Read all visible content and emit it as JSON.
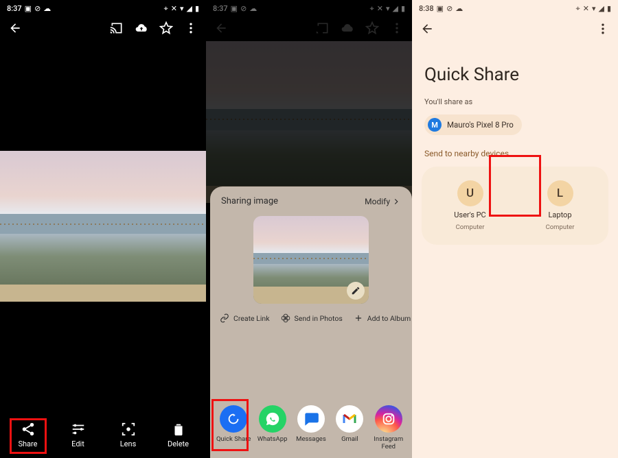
{
  "status": {
    "time1": "8:37",
    "time2": "8:37",
    "time3": "8:38"
  },
  "panel1": {
    "actions": {
      "share": "Share",
      "edit": "Edit",
      "lens": "Lens",
      "delete": "Delete"
    }
  },
  "panel2": {
    "sheet_title": "Sharing image",
    "modify": "Modify",
    "chips": {
      "create_link": "Create Link",
      "send_in_photos": "Send in Photos",
      "add_to_album": "Add to Album",
      "create": "Creat"
    },
    "apps": {
      "quickshare": "Quick Share",
      "whatsapp": "WhatsApp",
      "messages": "Messages",
      "gmail": "Gmail",
      "instagram": "Instagram Feed"
    }
  },
  "panel3": {
    "title": "Quick Share",
    "share_as_label": "You'll share as",
    "user_initial": "M",
    "user_name": "Mauro's Pixel 8 Pro",
    "nearby_heading": "Send to nearby devices",
    "devices": [
      {
        "initial": "U",
        "name": "User's PC",
        "type": "Computer"
      },
      {
        "initial": "L",
        "name": "Laptop",
        "type": "Computer"
      }
    ]
  }
}
